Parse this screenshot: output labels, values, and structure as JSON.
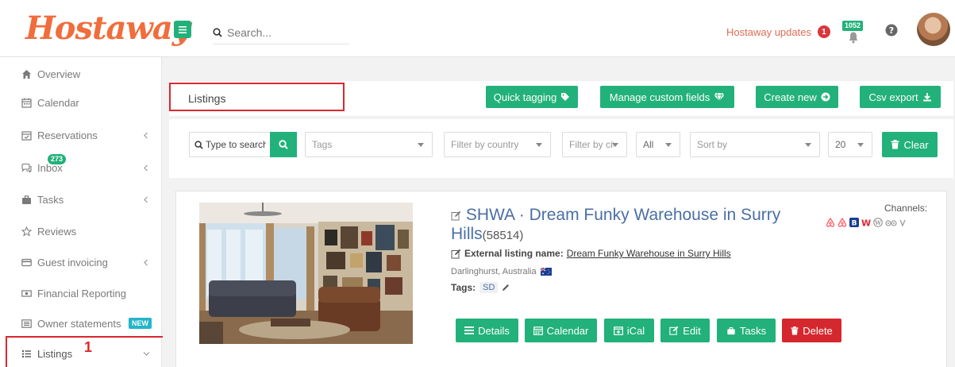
{
  "brand": {
    "logo_text": "Hostaway",
    "accent": "#22b17a",
    "logo_color": "#f06d3c",
    "danger": "#d4282e"
  },
  "topbar": {
    "search_placeholder": "Search...",
    "updates_label": "Hostaway updates",
    "updates_count": "1",
    "notifications_count": "1052"
  },
  "sidebar": {
    "items": [
      {
        "label": "Overview",
        "icon": "home-icon"
      },
      {
        "label": "Calendar",
        "icon": "calendar-icon"
      },
      {
        "label": "Reservations",
        "icon": "calendar-check-icon",
        "has_submenu": true
      },
      {
        "label": "Inbox",
        "icon": "comments-icon",
        "badge": "273",
        "has_submenu": true
      },
      {
        "label": "Tasks",
        "icon": "briefcase-icon",
        "has_submenu": true
      },
      {
        "label": "Reviews",
        "icon": "star-icon"
      },
      {
        "label": "Guest invoicing",
        "icon": "credit-card-icon",
        "has_submenu": true
      },
      {
        "label": "Financial Reporting",
        "icon": "money-icon"
      },
      {
        "label": "Owner statements",
        "icon": "list-alt-icon",
        "badge": "NEW"
      },
      {
        "label": "Listings",
        "icon": "list-icon",
        "has_submenu": true,
        "active": true
      }
    ],
    "step_marker": "1"
  },
  "header": {
    "title": "Listings",
    "buttons": {
      "quick_tagging": "Quick tagging",
      "manage_custom_fields": "Manage custom fields",
      "create_new": "Create new",
      "csv_export": "Csv export"
    }
  },
  "filters": {
    "search_placeholder": "Type to search",
    "tags": "Tags",
    "country": "Filter by country",
    "city": "Filter by city",
    "all": "All",
    "sort_by": "Sort by",
    "page_size": "20",
    "clear": "Clear"
  },
  "listing": {
    "title": "SHWA · Dream Funky Warehouse in Surry Hills",
    "id": "(58514)",
    "external_label": "External listing name:",
    "external_name": "Dream Funky Warehouse in Surry Hills",
    "location": "Darlinghurst, Australia",
    "tags_label": "Tags:",
    "tags": [
      "SD"
    ],
    "channels_label": "Channels:",
    "channel_icons": [
      "airbnb-icon",
      "airbnb-icon",
      "booking-icon",
      "w-channel-icon",
      "wordpress-icon",
      "tripadvisor-icon",
      "vrbo-icon"
    ],
    "actions": {
      "details": "Details",
      "calendar": "Calendar",
      "ical": "iCal",
      "edit": "Edit",
      "tasks": "Tasks",
      "delete": "Delete"
    }
  }
}
